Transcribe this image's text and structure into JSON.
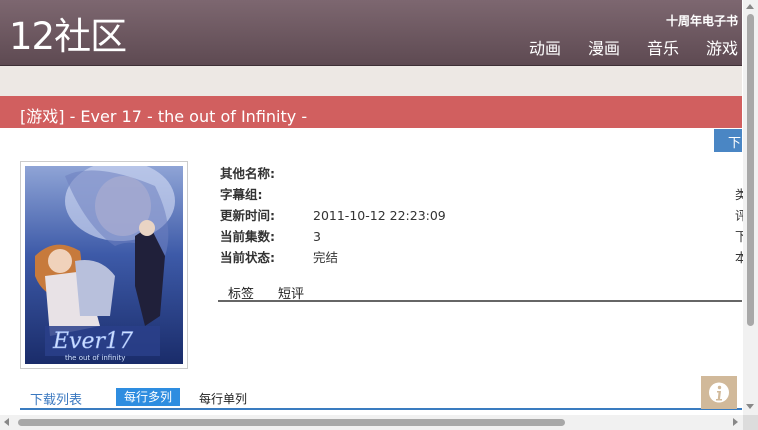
{
  "header": {
    "logo": "12社区",
    "top_link": "十周年电子书",
    "nav": [
      "动画",
      "漫画",
      "音乐",
      "游戏"
    ]
  },
  "title_bar": {
    "text": "[游戏] - Ever 17 - the out of Infinity -"
  },
  "download_tab": {
    "label": "下"
  },
  "details": {
    "rows": [
      {
        "label": "其他名称:",
        "value": "",
        "right": ""
      },
      {
        "label": "字幕组:",
        "value": "",
        "right": "类"
      },
      {
        "label": "更新时间:",
        "value": "2011-10-12 22:23:09",
        "right": "评"
      },
      {
        "label": "当前集数:",
        "value": "3",
        "right": "下"
      },
      {
        "label": "当前状态:",
        "value": "完结",
        "right": "本"
      }
    ],
    "subtabs": [
      "标签",
      "短评"
    ]
  },
  "download_list": {
    "title": "下载列表",
    "mode_active": "每行多列",
    "mode_other": "每行单列"
  },
  "colors": {
    "header_bg": "#6e5860",
    "title_bar_bg": "#d15f5f",
    "accent_blue": "#2e8de0",
    "download_tab_bg": "#4a86c4"
  },
  "icons": {
    "info_button": "info-icon"
  }
}
